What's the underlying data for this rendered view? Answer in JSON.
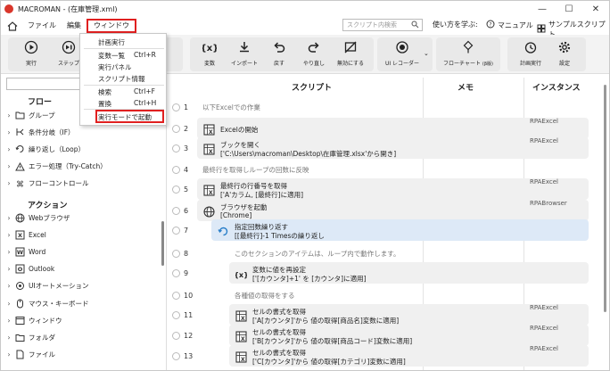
{
  "window": {
    "title": "MACROMAN - (在庫管理.xml)",
    "minimize": "—",
    "maximize": "☐",
    "close": "✕"
  },
  "menubar": {
    "items": [
      "ファイル",
      "編集",
      "ウィンドウ"
    ],
    "active_index": 2,
    "search_placeholder": "スクリプト内検索",
    "howto_label": "使い方を学ぶ:",
    "manual_label": "マニュアル",
    "sample_label": "サンプルスクリプト"
  },
  "toolbar": {
    "run": "実行",
    "step": "ステップ",
    "variable": "変数",
    "import": "インポート",
    "undo": "戻す",
    "redo": "やり直し",
    "disable": "無効にする",
    "recorder": "UI レコーダー",
    "flowchart": "フローチャート",
    "flowchart_tag": "(β版)",
    "schedule": "計画実行",
    "settings": "設定"
  },
  "dropdown": {
    "items": [
      {
        "label": "計画実行",
        "shortcut": ""
      },
      {
        "label": "変数一覧",
        "shortcut": "Ctrl+R"
      },
      {
        "label": "実行パネル",
        "shortcut": ""
      },
      {
        "label": "スクリプト情報",
        "shortcut": ""
      },
      {
        "label": "検索",
        "shortcut": "Ctrl+F"
      },
      {
        "label": "置換",
        "shortcut": "Ctrl+H"
      },
      {
        "label": "実行モードで起動",
        "shortcut": ""
      }
    ]
  },
  "leftpanel": {
    "flow_title": "フロー",
    "flow_items": [
      "グループ",
      "条件分岐（IF）",
      "繰り返し（Loop）",
      "エラー処理（Try-Catch）",
      "フローコントロール"
    ],
    "action_title": "アクション",
    "action_items": [
      "Webブラウザ",
      "Excel",
      "Word",
      "Outlook",
      "UIオートメーション",
      "マウス・キーボード",
      "ウィンドウ",
      "フォルダ",
      "ファイル"
    ]
  },
  "script": {
    "headers": {
      "script": "スクリプト",
      "memo": "メモ",
      "instance": "インスタンス"
    },
    "rows": [
      {
        "num": "1",
        "kind": "comment",
        "text": "以下Excelでの作業"
      },
      {
        "num": "2",
        "kind": "action",
        "icon": "excel",
        "line1": "Excelの開始",
        "line2": "",
        "instance": "RPAExcel"
      },
      {
        "num": "3",
        "kind": "action",
        "icon": "excel",
        "line1": "ブックを開く",
        "line2": "['C:\\Users\\macroman\\Desktop\\在庫管理.xlsx'から開き]",
        "instance": "RPAExcel"
      },
      {
        "num": "4",
        "kind": "comment",
        "text": "最終行を取得しループの回数に反映"
      },
      {
        "num": "5",
        "kind": "action",
        "icon": "excel",
        "line1": "最終行の行番号を取得",
        "line2": "['A'カラム, [最終行]に適用]",
        "instance": "RPAExcel"
      },
      {
        "num": "6",
        "kind": "action",
        "icon": "globe",
        "line1": "ブラウザを起動",
        "line2": "[Chrome]",
        "instance": "RPABrowser"
      },
      {
        "num": "7",
        "kind": "loop",
        "icon": "loop",
        "line1": "指定回数繰り返す",
        "line2": "[[最終行]-1 Timesの繰り返し",
        "instance": ""
      },
      {
        "num": "8",
        "kind": "comment",
        "text": "このセクションのアイテムは、ループ内で動作します。"
      },
      {
        "num": "9",
        "kind": "action",
        "icon": "var",
        "line1": "変数に値を再設定",
        "line2": "['[カウンタ]+1' を [カウンタ]に適用]",
        "instance": ""
      },
      {
        "num": "10",
        "kind": "comment",
        "text": "各種値の取得をする"
      },
      {
        "num": "11",
        "kind": "action",
        "icon": "excel",
        "line1": "セルの書式を取得",
        "line2": "['A[カウンタ]'から 値の取得[商品名]変数に適用]",
        "instance": "RPAExcel"
      },
      {
        "num": "12",
        "kind": "action",
        "icon": "excel",
        "line1": "セルの書式を取得",
        "line2": "['B[カウンタ]'から 値の取得[商品コード]変数に適用]",
        "instance": "RPAExcel"
      },
      {
        "num": "13",
        "kind": "action",
        "icon": "excel",
        "line1": "セルの書式を取得",
        "line2": "['C[カウンタ]'から 値の取得[カテゴリ]変数に適用]",
        "instance": "RPAExcel"
      }
    ]
  }
}
